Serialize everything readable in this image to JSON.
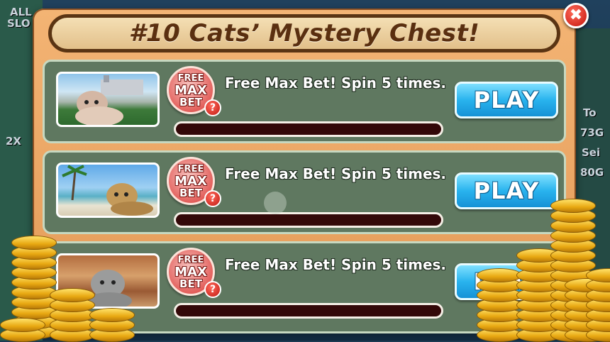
{
  "background": {
    "labels": [
      "ALL",
      "SLO",
      "2X",
      "To",
      "73G",
      "Sei",
      "80G"
    ]
  },
  "popup": {
    "title": "#10 Cats’ Mystery Chest!",
    "close_label": "✖"
  },
  "rows": [
    {
      "thumbnail": "kitten-garden-image",
      "badge": {
        "line1": "FREE",
        "line2": "MAX",
        "line3": "BET",
        "help": "?"
      },
      "description": "Free Max Bet! Spin 5 times.",
      "progress": 0,
      "button_label": "PLAY"
    },
    {
      "thumbnail": "kitten-beach-image",
      "badge": {
        "line1": "FREE",
        "line2": "MAX",
        "line3": "BET",
        "help": "?"
      },
      "description": "Free Max Bet! Spin 5 times.",
      "progress": 0,
      "button_label": "PLAY"
    },
    {
      "thumbnail": "kitten-rooftop-image",
      "badge": {
        "line1": "FREE",
        "line2": "MAX",
        "line3": "BET",
        "help": "?"
      },
      "description": "Free Max Bet! Spin 5 times.",
      "progress": 0,
      "button_label": "PLAY"
    }
  ],
  "colors": {
    "popup_bg": "#e9a362",
    "title_border": "#5a3413",
    "row_bg": "#5f7860",
    "play_button": "#29b3ee",
    "progress_track": "#330808",
    "close_button": "#d9231a"
  }
}
